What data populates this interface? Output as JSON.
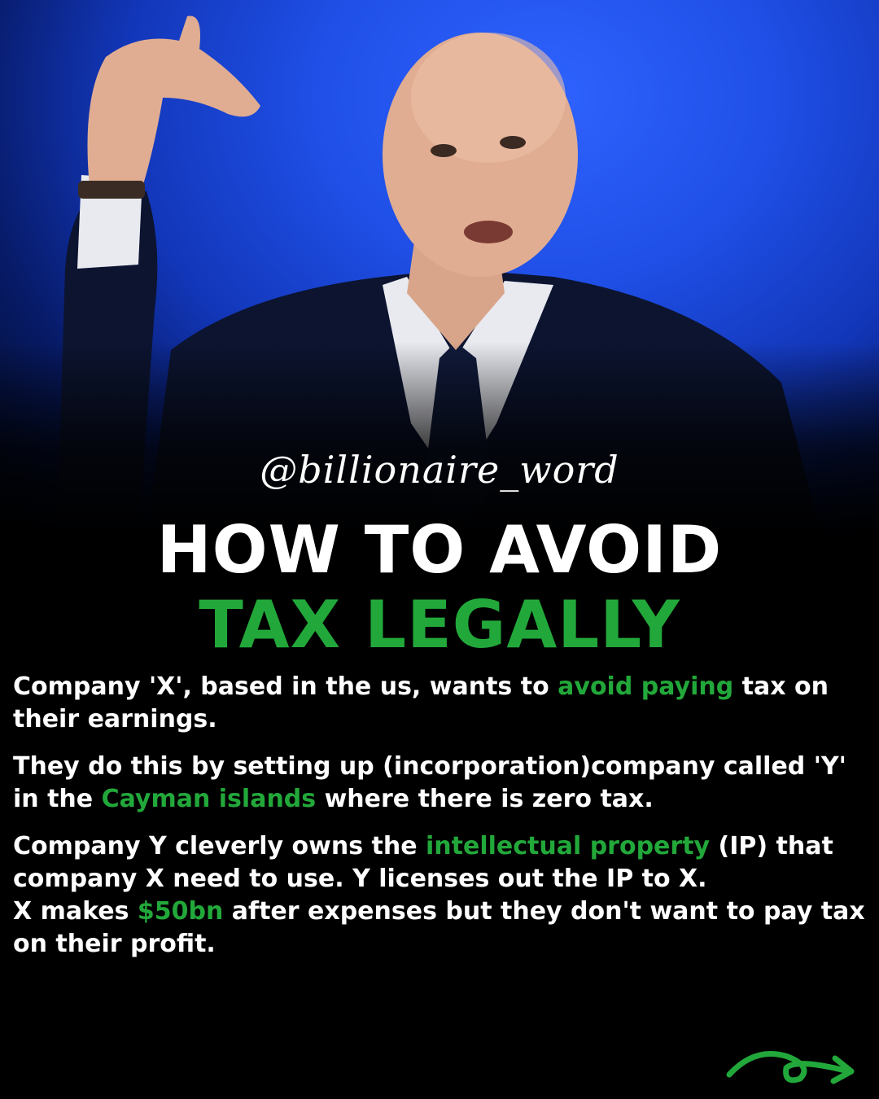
{
  "watermark": "@billionaire_word",
  "headline": {
    "line1": "HOW TO AVOID",
    "line2": "TAX LEGALLY"
  },
  "paragraphs": [
    {
      "before": "Company 'X', based in the us, wants to ",
      "highlight": "avoid paying",
      "after": " tax on their earnings."
    },
    {
      "before": "They do this by setting up (incorporation)company called 'Y' in the ",
      "highlight": "Cayman islands",
      "after": " where there is zero tax."
    },
    {
      "before": "Company Y cleverly owns the ",
      "highlight": "intellectual property",
      "after": " (IP) that company X need to use. Y licenses out the IP to X."
    },
    {
      "before": "X makes ",
      "highlight": "$50bn",
      "after": " after expenses but they don't want to pay tax on their profit."
    }
  ],
  "colors": {
    "background": "#000000",
    "highlight": "#22a83a",
    "text": "#ffffff",
    "photo_backdrop": "#1f4fe6"
  },
  "icons": [
    "next-arrow-icon"
  ]
}
